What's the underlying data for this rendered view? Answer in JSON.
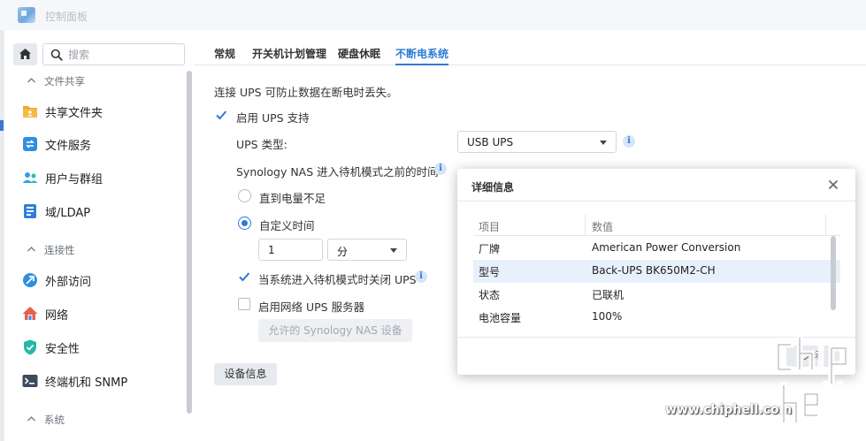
{
  "window": {
    "title": "控制面板"
  },
  "search": {
    "placeholder": "搜索"
  },
  "sidebar": {
    "sections": [
      {
        "label": "文件共享",
        "items": [
          "共享文件夹",
          "文件服务",
          "用户与群组",
          "域/LDAP"
        ]
      },
      {
        "label": "连接性",
        "items": [
          "外部访问",
          "网络",
          "安全性",
          "终端机和 SNMP"
        ]
      },
      {
        "label": "系统",
        "items": []
      }
    ]
  },
  "tabs": [
    "常规",
    "开关机计划管理",
    "硬盘休眠",
    "不断电系统"
  ],
  "ups": {
    "description": "连接 UPS 可防止数据在断电时丢失。",
    "enable_label": "启用 UPS 支持",
    "type_label": "UPS 类型:",
    "type_value": "USB UPS",
    "standby_label": "Synology NAS 进入待机模式之前的时间",
    "radio_until_low": "直到电量不足",
    "radio_custom": "自定义时间",
    "custom_value": "1",
    "custom_unit": "分",
    "shutdown_ups_label": "当系统进入待机模式时关闭 UPS",
    "network_ups_label": "启用网络 UPS 服务器",
    "allowed_devices_button": "允许的 Synology NAS 设备",
    "device_info_button": "设备信息"
  },
  "modal": {
    "title": "详细信息",
    "columns": [
      "项目",
      "数值"
    ],
    "rows": [
      [
        "厂牌",
        "American Power Conversion"
      ],
      [
        "型号",
        "Back-UPS BK650M2-CH"
      ],
      [
        "状态",
        "已联机"
      ],
      [
        "电池容量",
        "100%"
      ]
    ],
    "close_label": "关闭"
  },
  "watermark": {
    "site": "www.chiphell.com",
    "logo": "chip hell"
  },
  "colors": {
    "accent": "#2d7ad6",
    "highlight_row": "#e8f0fb"
  }
}
